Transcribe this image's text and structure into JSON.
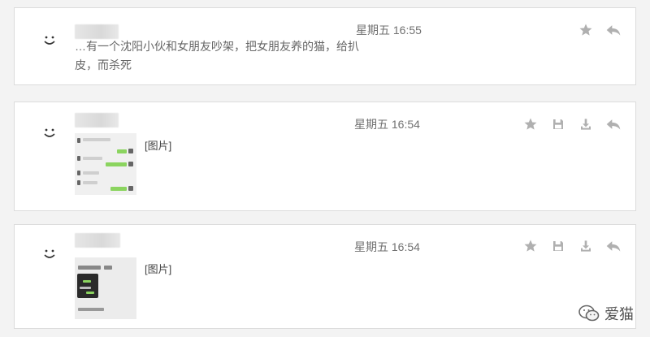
{
  "messages": [
    {
      "text_line1": "…有一个沈阳小伙和女朋友吵架，把女朋友养的猫，给扒",
      "text_line2": "皮，而杀死",
      "time": "星期五 16:55"
    },
    {
      "image_label": "[图片]",
      "time": "星期五 16:54"
    },
    {
      "image_label": "[图片]",
      "time": "星期五 16:54"
    }
  ],
  "icons": {
    "avatar": "smiley-icon",
    "star": "star-icon",
    "save": "save-icon",
    "download": "download-icon",
    "reply": "reply-icon"
  },
  "watermark": {
    "text": "爱猫"
  },
  "colors": {
    "icon_gray": "#b0b0b0",
    "chat_green": "#8bd45f",
    "card_border": "#dcdcdc"
  }
}
